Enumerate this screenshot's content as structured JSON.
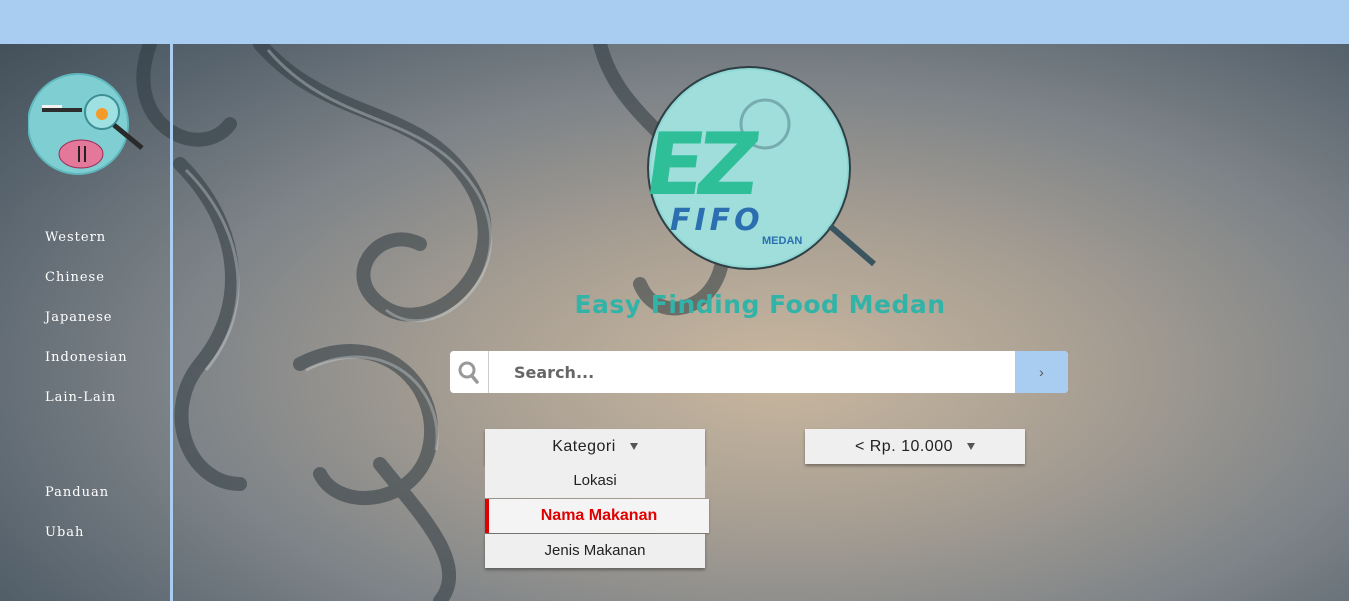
{
  "colors": {
    "topbar": "#a9cdf1",
    "accent_teal": "#32b3a8",
    "active_red": "#e10000",
    "logo_blue": "#2b6fb0"
  },
  "sidebar": {
    "categories": [
      "Western",
      "Chinese",
      "Japanese",
      "Indonesian",
      "Lain-Lain"
    ],
    "links": [
      "Panduan",
      "Ubah"
    ]
  },
  "logo": {
    "mark": "EZ",
    "word": "FIFO",
    "city": "MEDAN"
  },
  "tagline": "Easy Finding Food Medan",
  "search": {
    "placeholder": "Search...",
    "button": "›",
    "icon": "search-icon"
  },
  "filters": {
    "kategori": {
      "label": "Kategori",
      "icon": "caret-down-icon"
    },
    "price": {
      "label": "< Rp. 10.000",
      "icon": "caret-down-icon"
    }
  },
  "kategori_menu": {
    "options": [
      "Lokasi",
      "Nama Makanan",
      "Jenis Makanan"
    ],
    "selected": "Nama Makanan"
  }
}
